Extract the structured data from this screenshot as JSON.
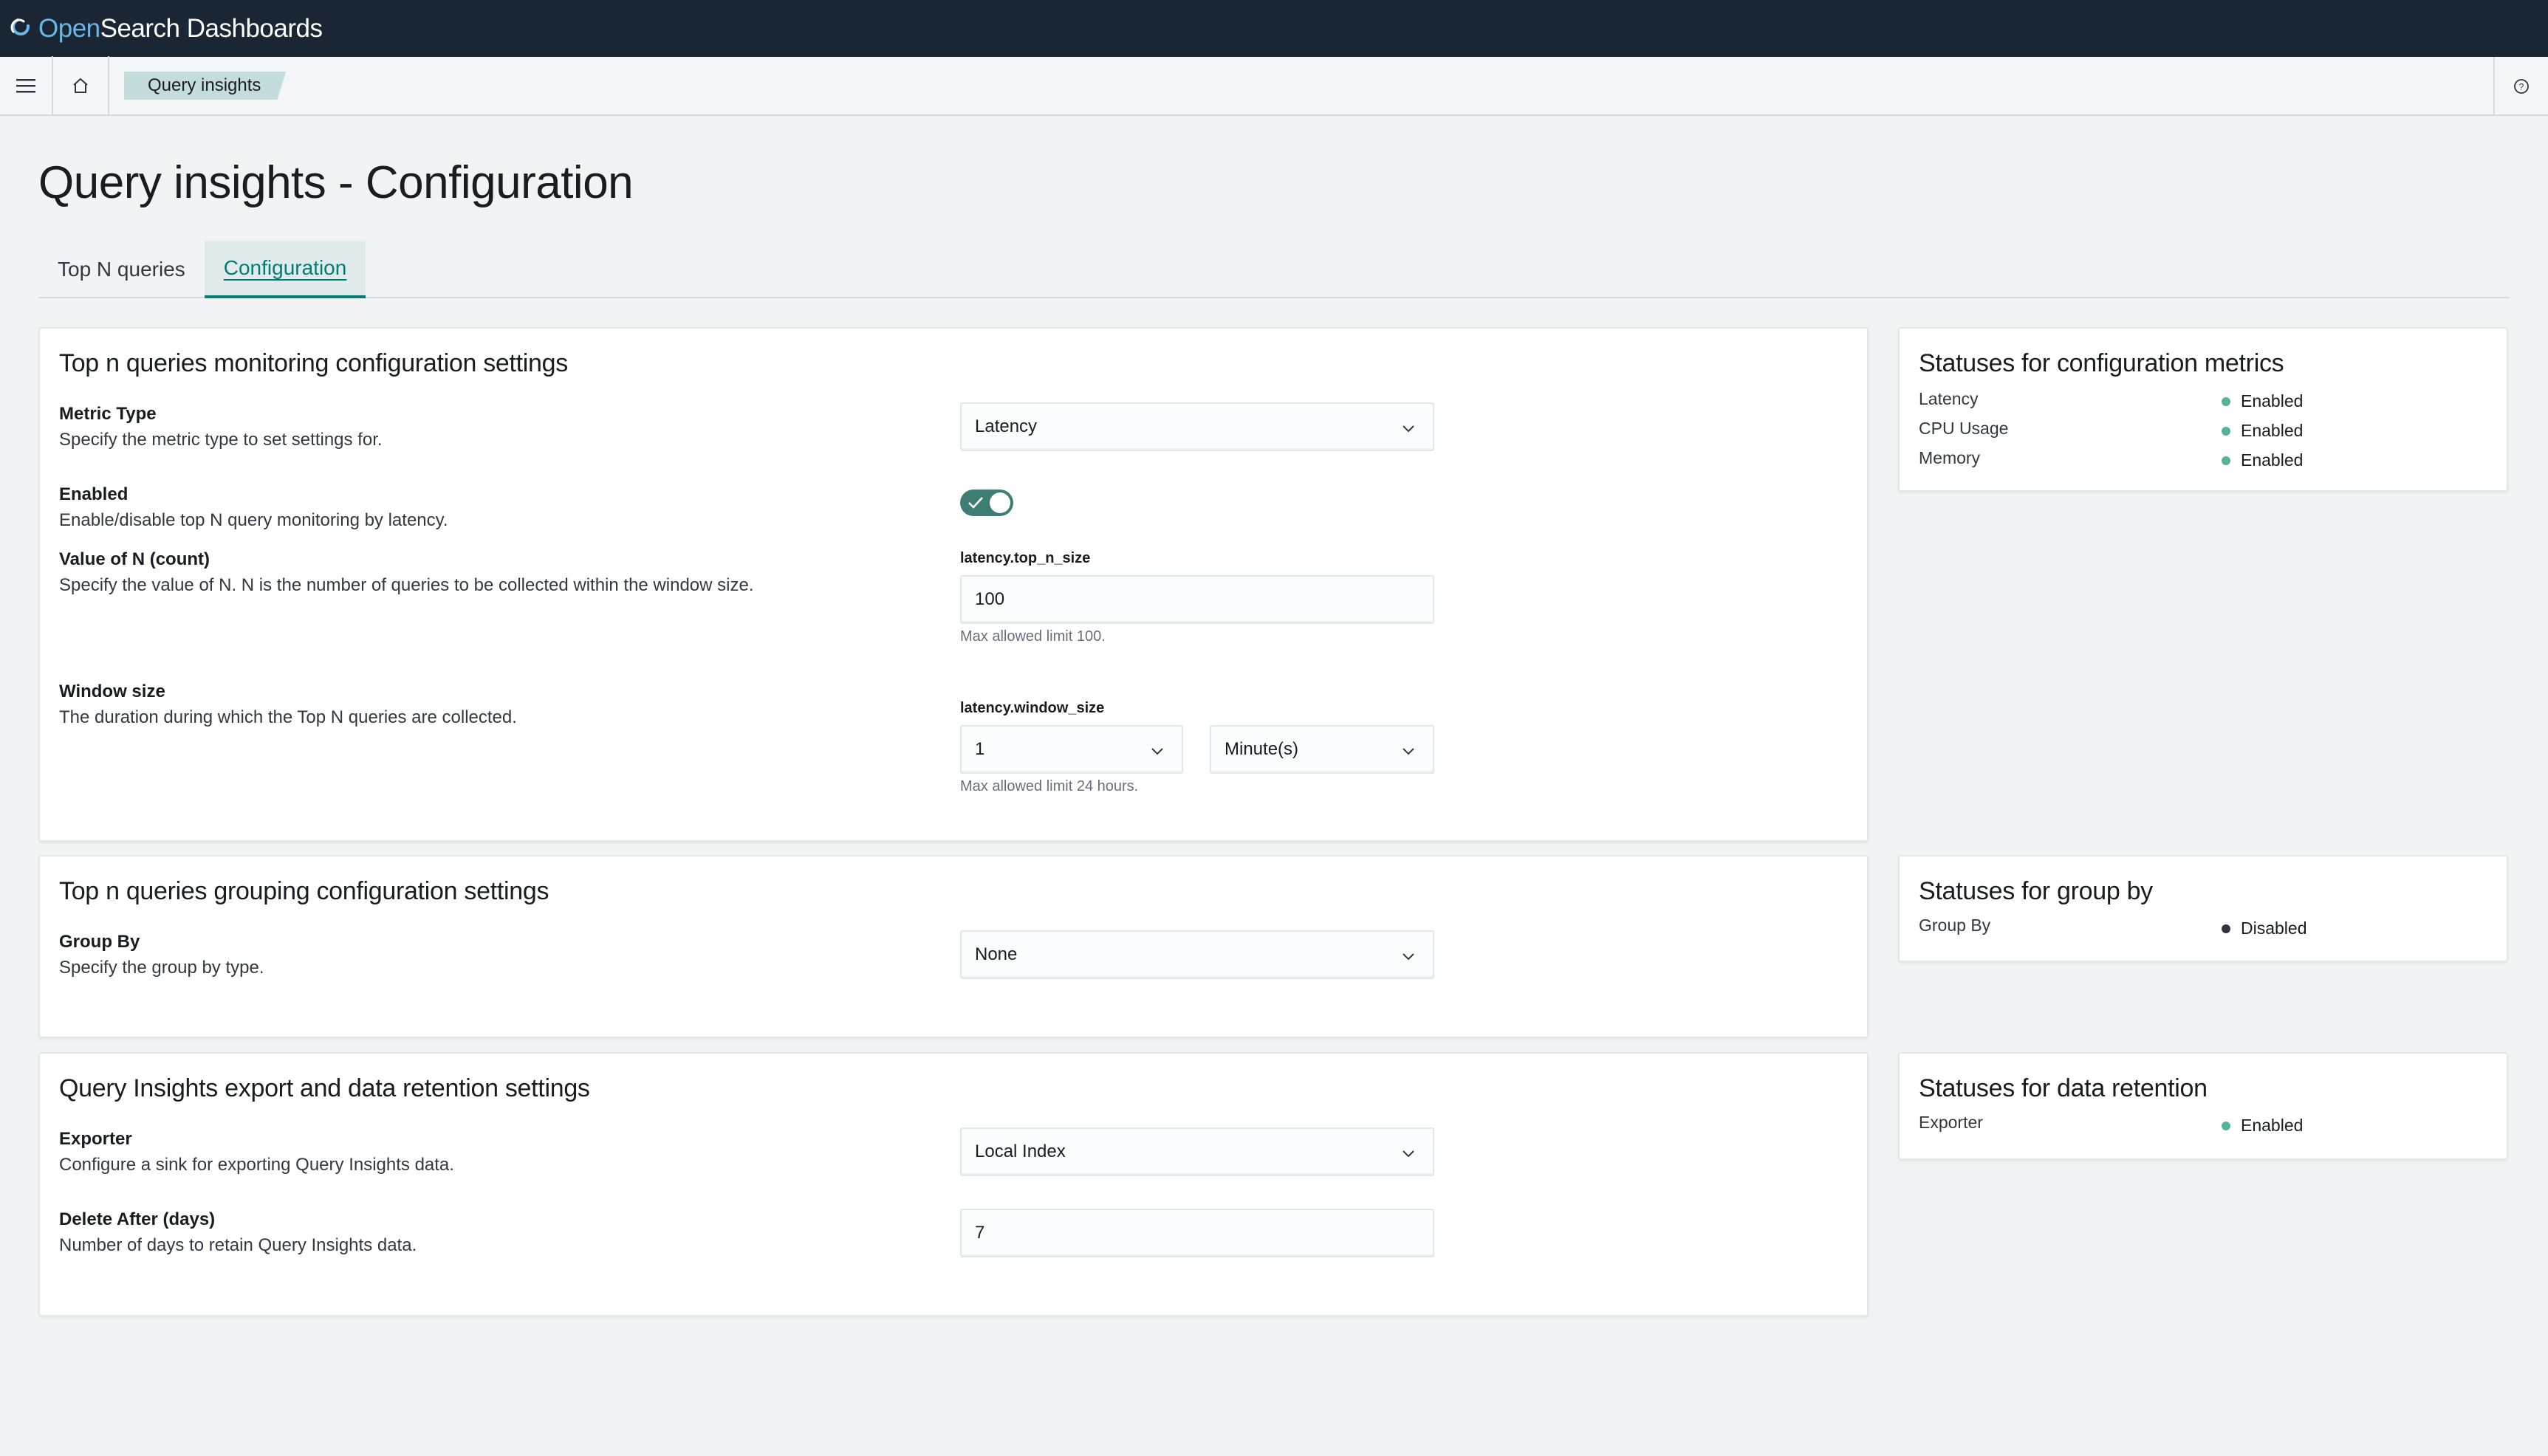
{
  "app": {
    "brand_open": "Open",
    "brand_rest": "Search Dashboards"
  },
  "breadcrumb": {
    "current": "Query insights"
  },
  "page": {
    "title": "Query insights - Configuration"
  },
  "tabs": [
    {
      "label": "Top N queries",
      "active": false
    },
    {
      "label": "Configuration",
      "active": true
    }
  ],
  "monitoring": {
    "title": "Top n queries monitoring configuration settings",
    "metric_type": {
      "label": "Metric Type",
      "desc": "Specify the metric type to set settings for.",
      "value": "Latency"
    },
    "enabled": {
      "label": "Enabled",
      "desc": "Enable/disable top N query monitoring by latency.",
      "on": true
    },
    "top_n": {
      "label": "Value of N (count)",
      "desc": "Specify the value of N. N is the number of queries to be collected within the window size.",
      "form_label": "latency.top_n_size",
      "value": "100",
      "help": "Max allowed limit 100."
    },
    "window": {
      "label": "Window size",
      "desc": "The duration during which the Top N queries are collected.",
      "form_label": "latency.window_size",
      "value": "1",
      "unit": "Minute(s)",
      "help": "Max allowed limit 24 hours."
    }
  },
  "grouping": {
    "title": "Top n queries grouping configuration settings",
    "group_by": {
      "label": "Group By",
      "desc": "Specify the group by type.",
      "value": "None"
    }
  },
  "export": {
    "title": "Query Insights export and data retention settings",
    "exporter": {
      "label": "Exporter",
      "desc": "Configure a sink for exporting Query Insights data.",
      "value": "Local Index"
    },
    "delete_after": {
      "label": "Delete After (days)",
      "desc": "Number of days to retain Query Insights data.",
      "value": "7"
    }
  },
  "status_metrics": {
    "title": "Statuses for configuration metrics",
    "items": [
      {
        "name": "Latency",
        "status": "Enabled"
      },
      {
        "name": "CPU Usage",
        "status": "Enabled"
      },
      {
        "name": "Memory",
        "status": "Enabled"
      }
    ]
  },
  "status_group": {
    "title": "Statuses for group by",
    "items": [
      {
        "name": "Group By",
        "status": "Disabled"
      }
    ]
  },
  "status_retention": {
    "title": "Statuses for data retention",
    "items": [
      {
        "name": "Exporter",
        "status": "Enabled"
      }
    ]
  },
  "colors": {
    "enabled_dot": "#54b399",
    "disabled_dot": "#343741",
    "accent": "#017d73",
    "topbar": "#1a2634"
  },
  "icons": [
    "menu-icon",
    "home-icon",
    "help-icon",
    "chevron-down-icon",
    "check-icon",
    "opensearch-logo-icon"
  ]
}
